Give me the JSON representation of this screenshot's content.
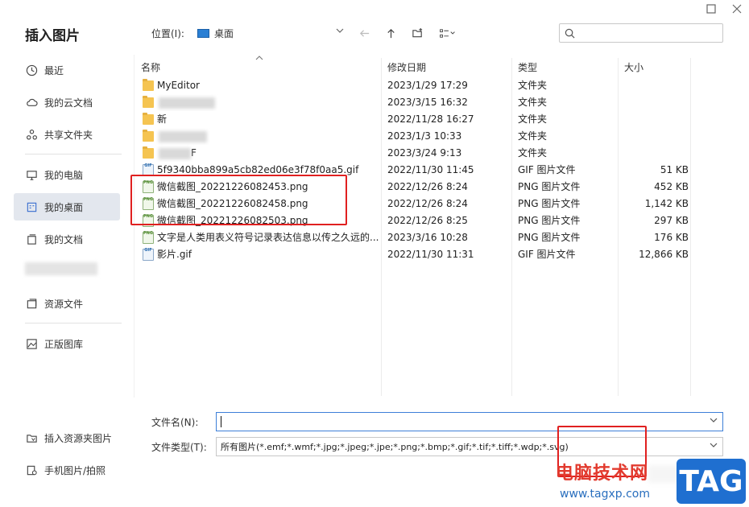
{
  "window": {
    "title": "插入图片"
  },
  "toolbar": {
    "location_label": "位置(I):",
    "location_value": "桌面",
    "search_placeholder": ""
  },
  "sidebar": {
    "items": [
      {
        "label": "最近",
        "icon": "clock-icon"
      },
      {
        "label": "我的云文档",
        "icon": "cloud-icon"
      },
      {
        "label": "共享文件夹",
        "icon": "share-icon"
      },
      {
        "label": "我的电脑",
        "icon": "computer-icon"
      },
      {
        "label": "我的桌面",
        "icon": "desktop-icon"
      },
      {
        "label": "我的文档",
        "icon": "documents-icon"
      },
      {
        "label": "资源文件",
        "icon": "resources-icon"
      },
      {
        "label": "正版图库",
        "icon": "gallery-icon"
      },
      {
        "label": "插入资源夹图片",
        "icon": "resource-folder-icon"
      },
      {
        "label": "手机图片/拍照",
        "icon": "phone-photo-icon"
      }
    ]
  },
  "filelist": {
    "columns": [
      "名称",
      "修改日期",
      "类型",
      "大小"
    ],
    "rows": [
      {
        "name": "MyEditor",
        "date": "2023/1/29 17:29",
        "type": "文件夹",
        "size": "",
        "kind": "folder"
      },
      {
        "name": "",
        "date": "2023/3/15 16:32",
        "type": "文件夹",
        "size": "",
        "kind": "folder"
      },
      {
        "name": "新",
        "date": "2022/11/28 16:27",
        "type": "文件夹",
        "size": "",
        "kind": "folder"
      },
      {
        "name": "",
        "date": "2023/1/3 10:33",
        "type": "文件夹",
        "size": "",
        "kind": "folder"
      },
      {
        "name": "F",
        "date": "2023/3/24 9:13",
        "type": "文件夹",
        "size": "",
        "kind": "folder"
      },
      {
        "name": "5f9340bba899a5cb82ed06e3f78f0aa5.gif",
        "date": "2022/11/30 11:45",
        "type": "GIF 图片文件",
        "size": "51 KB",
        "kind": "gif"
      },
      {
        "name": "微信截图_20221226082453.png",
        "date": "2022/12/26 8:24",
        "type": "PNG 图片文件",
        "size": "452 KB",
        "kind": "png"
      },
      {
        "name": "微信截图_20221226082458.png",
        "date": "2022/12/26 8:24",
        "type": "PNG 图片文件",
        "size": "1,142 KB",
        "kind": "png"
      },
      {
        "name": "微信截图_20221226082503.png",
        "date": "2022/12/26 8:25",
        "type": "PNG 图片文件",
        "size": "297 KB",
        "kind": "png"
      },
      {
        "name": "文字是人类用表义符号记录表达信息以传之久远的...",
        "date": "2023/3/16 10:28",
        "type": "PNG 图片文件",
        "size": "176 KB",
        "kind": "png"
      },
      {
        "name": "影片.gif",
        "date": "2022/11/30 11:31",
        "type": "GIF 图片文件",
        "size": "12,866 KB",
        "kind": "gif"
      }
    ]
  },
  "form": {
    "filename_label": "文件名(N):",
    "filename_value": "",
    "filetype_label": "文件类型(T):",
    "filetype_value": "所有图片(*.emf;*.wmf;*.jpg;*.jpeg;*.jpe;*.png;*.bmp;*.gif;*.tif;*.tiff;*.wdp;*.svg)"
  },
  "watermark": {
    "cn_text": "电脑技术网",
    "url": "www.tagxp.com",
    "tag": "TAG"
  },
  "colors": {
    "highlight": "#e02020",
    "active_sidebar": "#e3e7ee",
    "brand_blue": "#1f6fd0"
  }
}
